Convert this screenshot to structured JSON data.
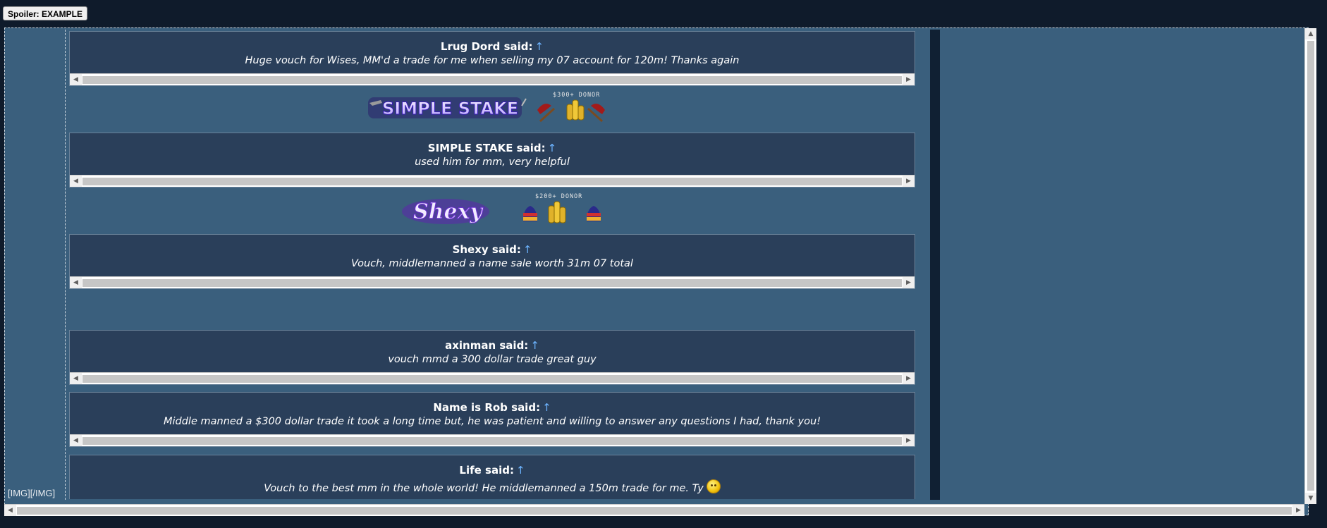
{
  "spoiler": {
    "label": "Spoiler: EXAMPLE"
  },
  "quotes": [
    {
      "author": "Lrug Dord said:",
      "arrow": "↑",
      "text": "Huge vouch for Wises, MM'd a trade for me when selling my 07 account for 120m! Thanks again"
    },
    {
      "author": "SIMPLE STAKE said:",
      "arrow": "↑",
      "text": "used him for mm, very helpful"
    },
    {
      "author": "Shexy said:",
      "arrow": "↑",
      "text": "Vouch, middlemanned a name sale worth 31m 07 total"
    },
    {
      "author": "axinman said:",
      "arrow": "↑",
      "text": "vouch mmd a 300 dollar trade great guy"
    },
    {
      "author": "Name is Rob said:",
      "arrow": "↑",
      "text": "Middle manned a $300 dollar trade it took a long time but, he was patient and willing to answer any questions I had, thank you!"
    },
    {
      "author": "Life said:",
      "arrow": "↑",
      "text": "Vouch to the best mm in the whole world! He middlemanned a 150m trade for me. Ty"
    }
  ],
  "signatures": [
    {
      "logo_text": "SIMPLE STAKE",
      "donor_label": "$300+ DONOR"
    },
    {
      "logo_text": "Shexy",
      "donor_label": "$200+ DONOR"
    }
  ],
  "img_code": "[IMG][/IMG]",
  "icons": {
    "emoji": "smile-emoji-icon",
    "arrow_up": "arrow-up-icon",
    "axe": "axe-icon",
    "coins": "coin-stack-icon",
    "hat": "partyhat-icon"
  },
  "colors": {
    "page_bg": "#0f1b2b",
    "spoiler_bg": "#3a5f7d",
    "quote_bg": "#2a3f5a",
    "arrow": "#6db4ff"
  }
}
